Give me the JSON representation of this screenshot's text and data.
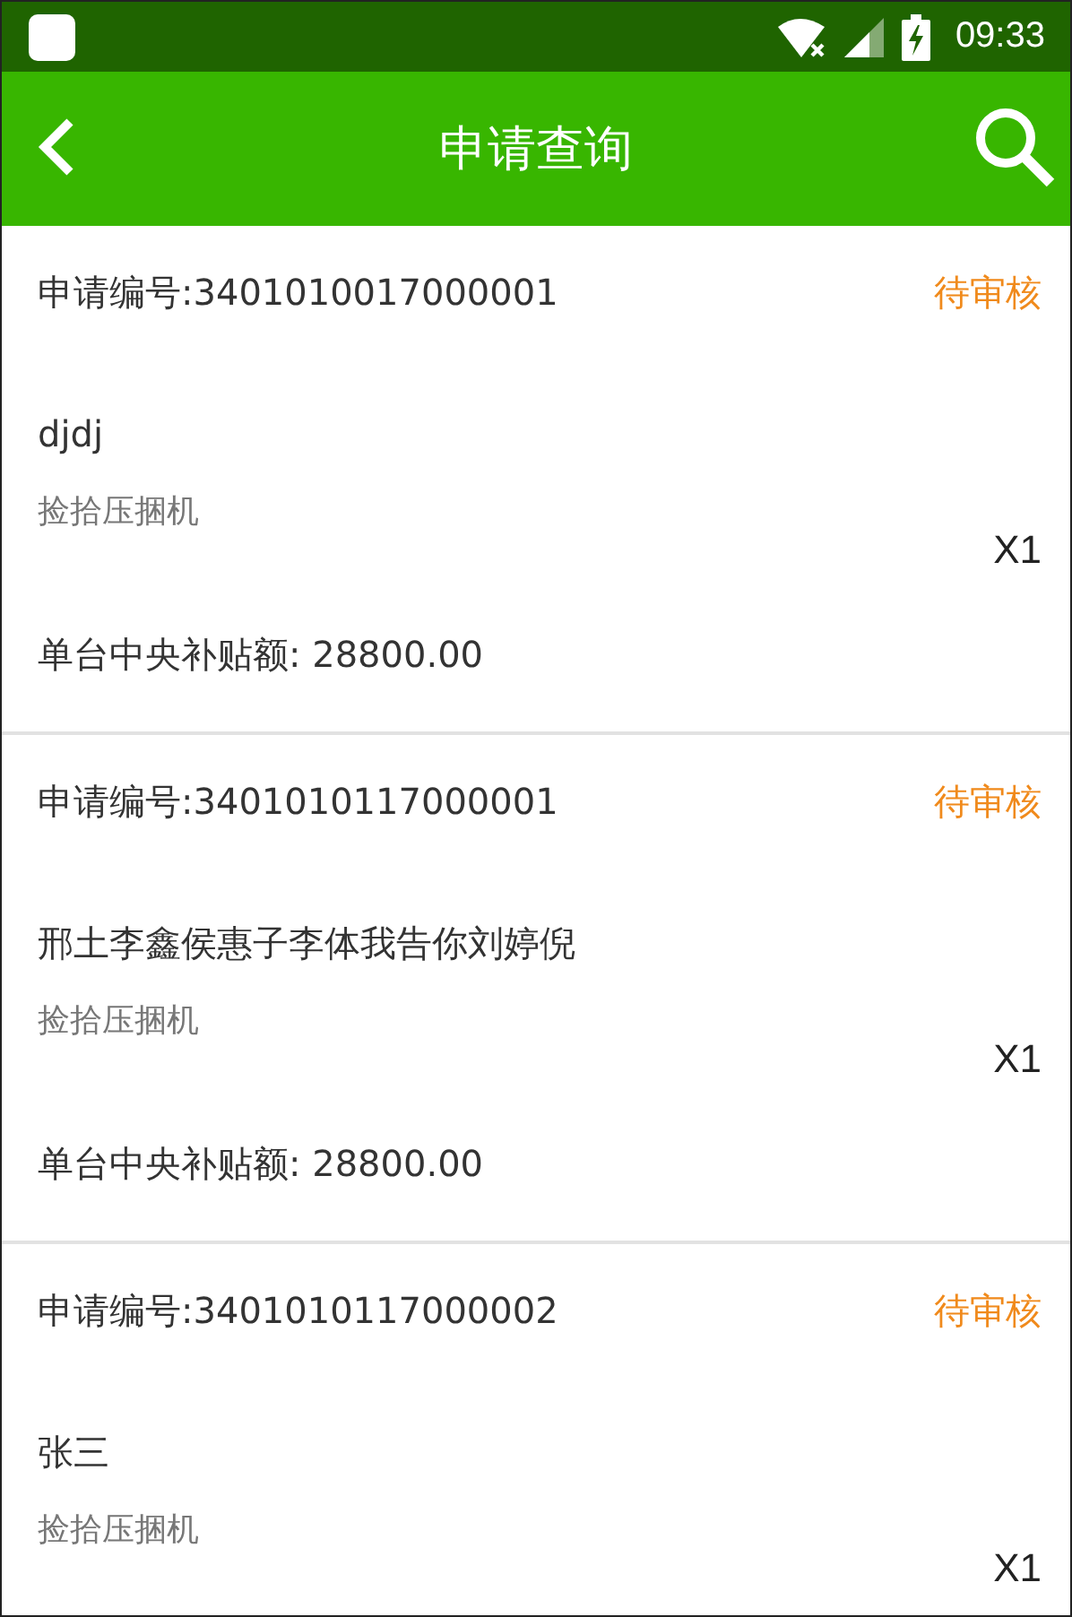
{
  "status_bar": {
    "time": "09:33"
  },
  "app_bar": {
    "title": "申请查询"
  },
  "applications": [
    {
      "number": "申请编号:3401010017000001",
      "status": "待审核",
      "name": "djdj",
      "product": "捡拾压捆机",
      "quantity": "X1",
      "subsidy": "单台中央补贴额: 28800.00"
    },
    {
      "number": "申请编号:3401010117000001",
      "status": "待审核",
      "name": "邢土李鑫侯惠子李体我告你刘婷倪",
      "product": "捡拾压捆机",
      "quantity": "X1",
      "subsidy": "单台中央补贴额: 28800.00"
    },
    {
      "number": "申请编号:3401010117000002",
      "status": "待审核",
      "name": "张三",
      "product": "捡拾压捆机",
      "quantity": "X1"
    }
  ]
}
